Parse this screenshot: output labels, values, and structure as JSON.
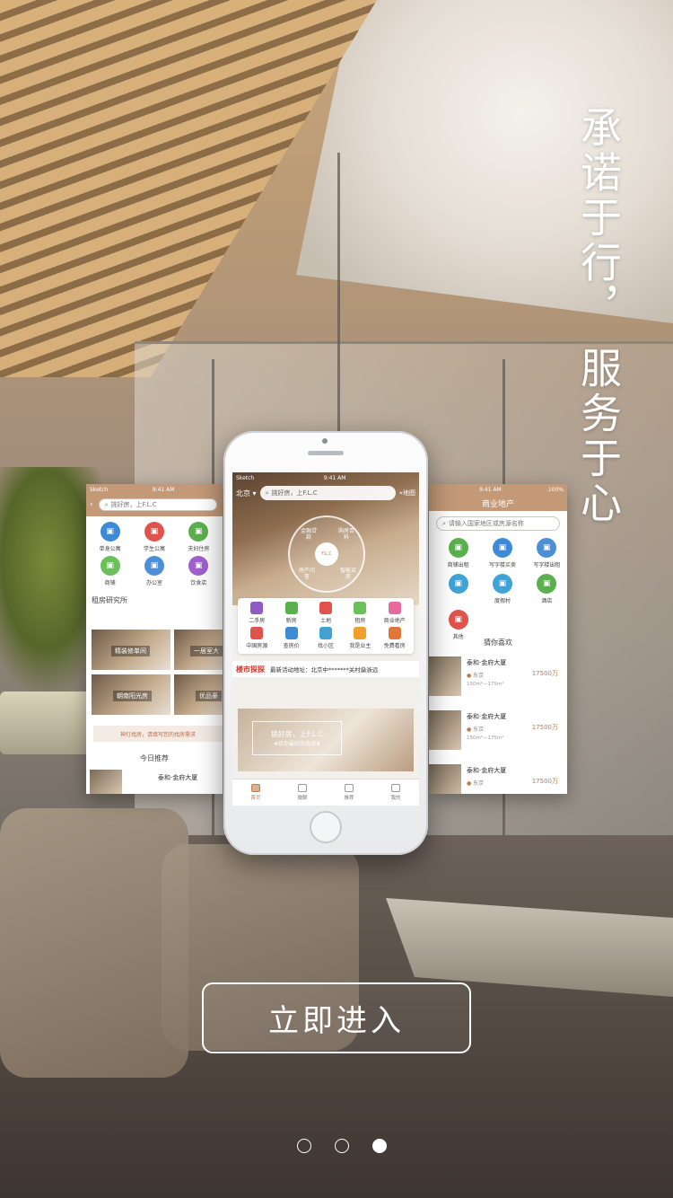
{
  "slogan": {
    "line1": "承诺于行，",
    "line2": "服务于心"
  },
  "left_screen": {
    "status_left": "Sketch",
    "status_time": "9:41 AM",
    "search_placeholder": "挑好房，上F.L.C",
    "icons": [
      {
        "label": "单身公寓",
        "color": "#3d8ad6"
      },
      {
        "label": "学生公寓",
        "color": "#e2524c"
      },
      {
        "label": "夫妇住房",
        "color": "#5ab04d"
      },
      {
        "label": "商铺",
        "color": "#6cc05a"
      },
      {
        "label": "办公室",
        "color": "#4d8fd6"
      },
      {
        "label": "饮食店",
        "color": "#a05fcf"
      }
    ],
    "section_title": "租房研究所",
    "photo1_label": "精装修单间",
    "photo2_label": "一居室大",
    "photo3_label": "朝南阳光房",
    "photo4_label": "优品豪",
    "tip": "神灯找房，请填写您的找房需求",
    "recommend_title": "今日推荐",
    "recommend_item": "泰和·金府大厦"
  },
  "phone": {
    "status_left": "Sketch",
    "status_time": "9:41 AM",
    "city": "北京",
    "search_placeholder": "挑好房，上F.L.C",
    "map_label": "地图",
    "logo": "F.L.C",
    "ring_items": [
      "金融贷款",
      "购房百科",
      "房产问答",
      "智能买房"
    ],
    "menu": [
      {
        "label": "二手房",
        "color": "#8f5ac4"
      },
      {
        "label": "新房",
        "color": "#5ab04d"
      },
      {
        "label": "土地",
        "color": "#e2524c"
      },
      {
        "label": "租房",
        "color": "#6cc05a"
      },
      {
        "label": "商业地产",
        "color": "#e76b9d"
      },
      {
        "label": "中国房源",
        "color": "#e2524c"
      },
      {
        "label": "查房价",
        "color": "#3d8ad6"
      },
      {
        "label": "找小区",
        "color": "#3fa3d8"
      },
      {
        "label": "我是业主",
        "color": "#f0a02a"
      },
      {
        "label": "免费看房",
        "color": "#e2763a"
      }
    ],
    "news_tag": "楼市探探",
    "news_text": "最新活动地址：北京中*******关村燊浙远",
    "banner_title": "挑好房，上F.L.C",
    "banner_sub": "#给你最好的选择#",
    "tabs": [
      "首页",
      "微聊",
      "推荐",
      "我的"
    ]
  },
  "right_screen": {
    "status_time": "9:41 AM",
    "battery": "100%",
    "title": "商业地产",
    "search_placeholder": "请输入国家地区或房源名称",
    "icons": [
      {
        "label": "商铺出租",
        "color": "#5ab04d"
      },
      {
        "label": "写字楼买卖",
        "color": "#3d8ad6"
      },
      {
        "label": "写字楼出租",
        "color": "#4d8fd6"
      },
      {
        "label": "",
        "color": "#3fa3d8"
      },
      {
        "label": "度假村",
        "color": "#3fa3d8"
      },
      {
        "label": "酒店",
        "color": "#5ab04d"
      },
      {
        "label": "其他",
        "color": "#e2524c"
      }
    ],
    "guess_title": "猜你喜欢",
    "listings": [
      {
        "title": "泰和·金府大厦",
        "loc": "东京",
        "area": "150m²—175m²",
        "price": "17500万"
      },
      {
        "title": "泰和·金府大厦",
        "loc": "东京",
        "area": "150m²—175m²",
        "price": "17500万"
      },
      {
        "title": "泰和·金府大厦",
        "loc": "东京",
        "area": "",
        "price": "17500万"
      }
    ]
  },
  "enter_button": "立即进入",
  "pager": {
    "count": 3,
    "active_index": 2
  }
}
